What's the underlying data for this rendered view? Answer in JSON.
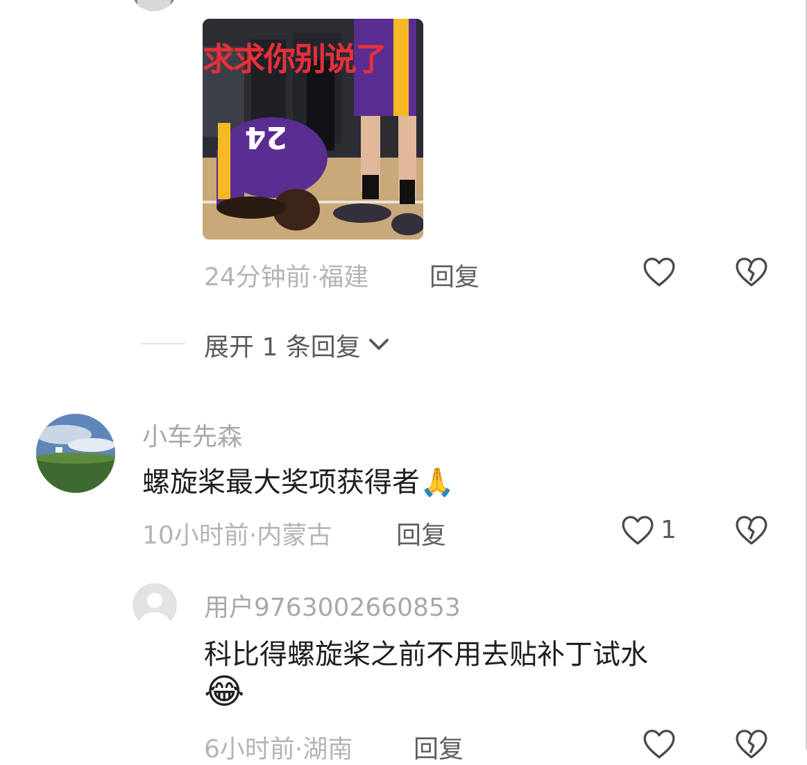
{
  "comment1": {
    "meme_caption": "求求你别说了",
    "meme_jersey_number": "24",
    "time": "24分钟前",
    "location": "福建",
    "reply_label": "回复",
    "like_icon": "heart-outline-icon",
    "dislike_icon": "broken-heart-icon"
  },
  "expand_replies": {
    "label": "展开 1 条回复",
    "icon": "chevron-down-icon"
  },
  "comment2": {
    "username": "小车先森",
    "text": "螺旋桨最大奖项获得者",
    "emoji": "🙏",
    "time": "10小时前",
    "location": "内蒙古",
    "reply_label": "回复",
    "like_count": "1"
  },
  "reply1": {
    "username": "用户9763002660853",
    "text_line1": "科比得螺旋桨之前不用去贴补丁试水",
    "emoji": "😂",
    "time": "6小时前",
    "location": "湖南",
    "reply_label": "回复"
  },
  "colors": {
    "meta_gray": "#b4b4b4",
    "meme_text_red": "#e8303a",
    "lakers_purple": "#5a2d91",
    "lakers_gold": "#f4b925"
  }
}
